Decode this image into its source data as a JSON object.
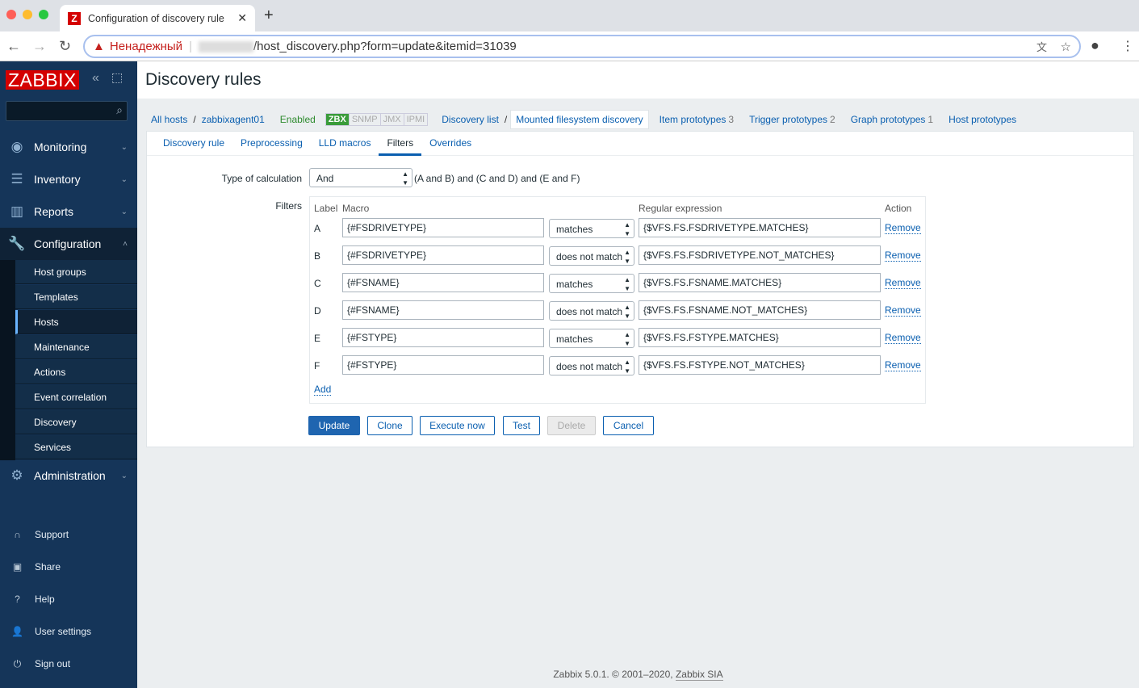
{
  "browser": {
    "tab_title": "Configuration of discovery rule",
    "insecure_label": "Ненадежный",
    "url": "/host_discovery.php?form=update&itemid=31039"
  },
  "sidebar": {
    "logo": "ZABBIX",
    "menu": [
      {
        "label": "Monitoring",
        "icon": "eye-icon"
      },
      {
        "label": "Inventory",
        "icon": "list-icon"
      },
      {
        "label": "Reports",
        "icon": "chart-icon"
      },
      {
        "label": "Configuration",
        "icon": "wrench-icon"
      },
      {
        "label": "Administration",
        "icon": "gear-icon"
      }
    ],
    "submenu": [
      "Host groups",
      "Templates",
      "Hosts",
      "Maintenance",
      "Actions",
      "Event correlation",
      "Discovery",
      "Services"
    ],
    "active_sub": "Hosts",
    "bottom": [
      {
        "label": "Support",
        "icon": "headset-icon"
      },
      {
        "label": "Share",
        "icon": "share-icon"
      },
      {
        "label": "Help",
        "icon": "help-icon"
      },
      {
        "label": "User settings",
        "icon": "user-icon"
      },
      {
        "label": "Sign out",
        "icon": "power-icon"
      }
    ]
  },
  "header": {
    "title": "Discovery rules"
  },
  "breadcrumb": {
    "all_hosts": "All hosts",
    "host": "zabbixagent01",
    "status": "Enabled",
    "badges": [
      "ZBX",
      "SNMP",
      "JMX",
      "IPMI"
    ],
    "discovery_list": "Discovery list",
    "current": "Mounted filesystem discovery",
    "links": [
      {
        "label": "Item prototypes",
        "count": "3"
      },
      {
        "label": "Trigger prototypes",
        "count": "2"
      },
      {
        "label": "Graph prototypes",
        "count": "1"
      },
      {
        "label": "Host prototypes",
        "count": ""
      }
    ]
  },
  "tabs": [
    "Discovery rule",
    "Preprocessing",
    "LLD macros",
    "Filters",
    "Overrides"
  ],
  "active_tab": "Filters",
  "form": {
    "calc_label": "Type of calculation",
    "calc_value": "And",
    "calc_formula": "(A and B) and (C and D) and (E and F)",
    "filters_label": "Filters",
    "columns": {
      "label": "Label",
      "macro": "Macro",
      "regex": "Regular expression",
      "action": "Action"
    },
    "rows": [
      {
        "label": "A",
        "macro": "{#FSDRIVETYPE}",
        "op": "matches",
        "regex": "{$VFS.FS.FSDRIVETYPE.MATCHES}",
        "action": "Remove"
      },
      {
        "label": "B",
        "macro": "{#FSDRIVETYPE}",
        "op": "does not match",
        "regex": "{$VFS.FS.FSDRIVETYPE.NOT_MATCHES}",
        "action": "Remove"
      },
      {
        "label": "C",
        "macro": "{#FSNAME}",
        "op": "matches",
        "regex": "{$VFS.FS.FSNAME.MATCHES}",
        "action": "Remove"
      },
      {
        "label": "D",
        "macro": "{#FSNAME}",
        "op": "does not match",
        "regex": "{$VFS.FS.FSNAME.NOT_MATCHES}",
        "action": "Remove"
      },
      {
        "label": "E",
        "macro": "{#FSTYPE}",
        "op": "matches",
        "regex": "{$VFS.FS.FSTYPE.MATCHES}",
        "action": "Remove"
      },
      {
        "label": "F",
        "macro": "{#FSTYPE}",
        "op": "does not match",
        "regex": "{$VFS.FS.FSTYPE.NOT_MATCHES}",
        "action": "Remove"
      }
    ],
    "add": "Add",
    "buttons": {
      "update": "Update",
      "clone": "Clone",
      "execute": "Execute now",
      "test": "Test",
      "delete": "Delete",
      "cancel": "Cancel"
    }
  },
  "footer": {
    "text": "Zabbix 5.0.1. © 2001–2020, ",
    "company": "Zabbix SIA"
  }
}
